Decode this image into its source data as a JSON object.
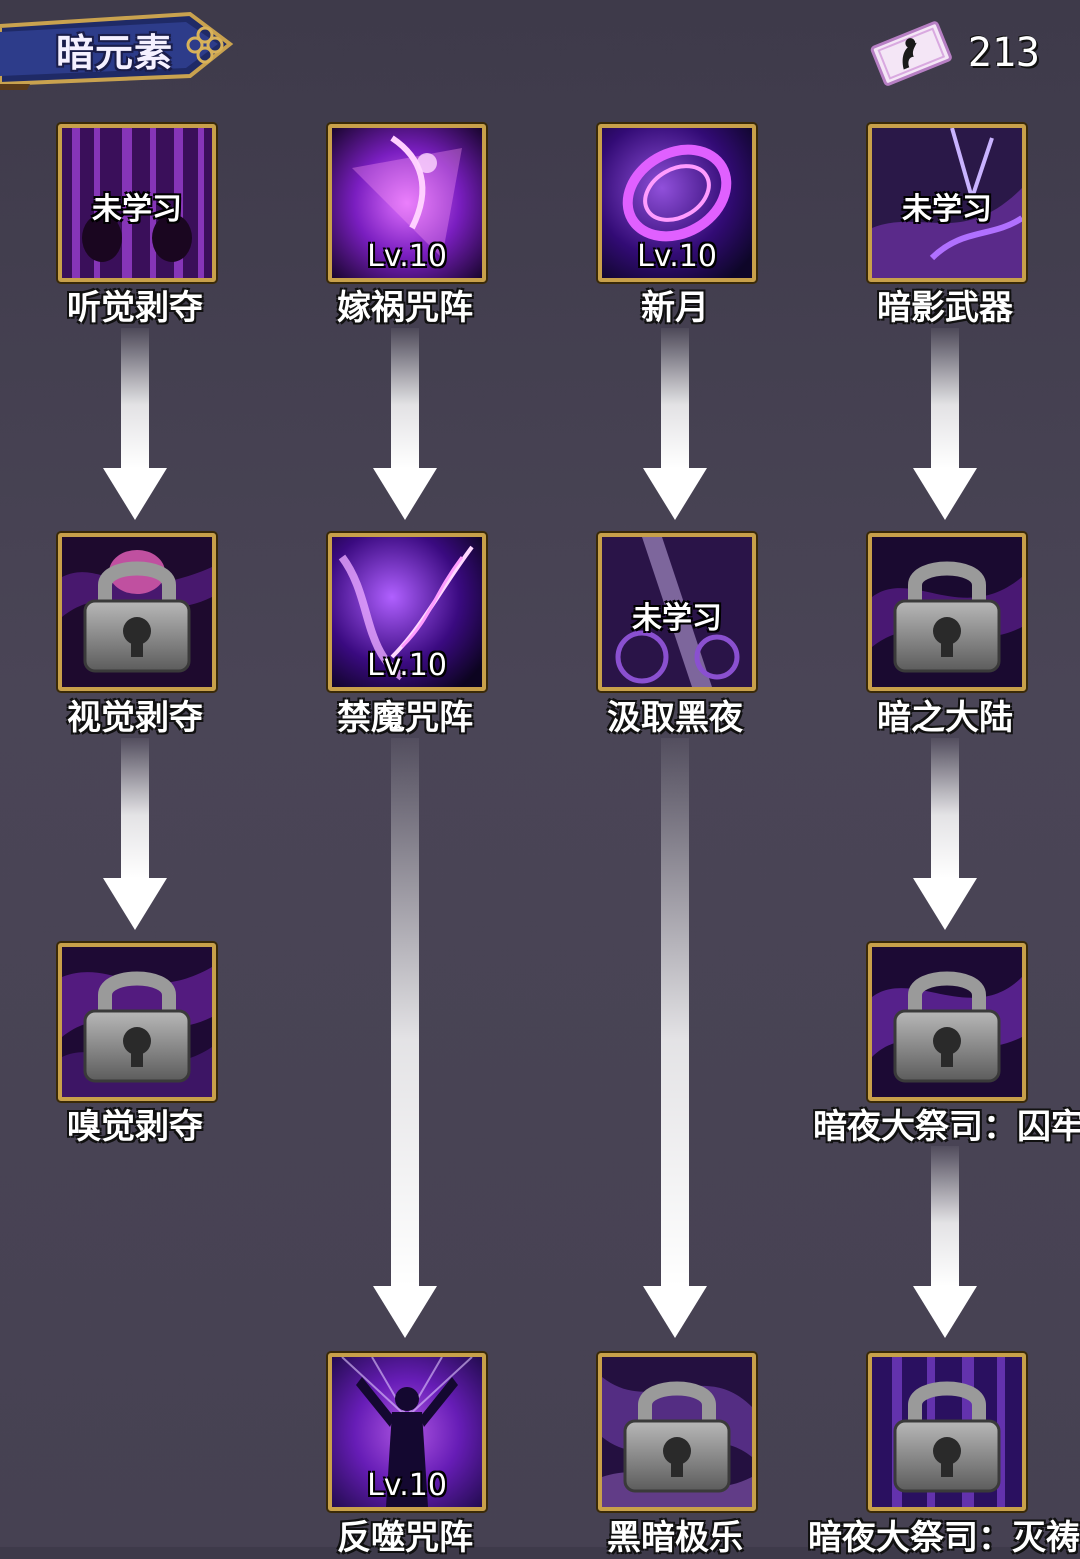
{
  "header": {
    "title": "暗元素",
    "currency_value": "213"
  },
  "skills": {
    "s11": {
      "name": "听觉剥夺",
      "status": "未学习"
    },
    "s12": {
      "name": "嫁祸咒阵",
      "level": "Lv.10"
    },
    "s13": {
      "name": "新月",
      "level": "Lv.10"
    },
    "s14": {
      "name": "暗影武器",
      "status": "未学习"
    },
    "s21": {
      "name": "视觉剥夺"
    },
    "s22": {
      "name": "禁魔咒阵",
      "level": "Lv.10"
    },
    "s23": {
      "name": "汲取黑夜",
      "status": "未学习"
    },
    "s24": {
      "name": "暗之大陆"
    },
    "s31": {
      "name": "嗅觉剥夺"
    },
    "s34": {
      "name": "暗夜大祭司：囚牢"
    },
    "s42": {
      "name": "反噬咒阵",
      "level": "Lv.10"
    },
    "s43": {
      "name": "黑暗极乐"
    },
    "s44": {
      "name": "暗夜大祭司：灭祷"
    }
  }
}
